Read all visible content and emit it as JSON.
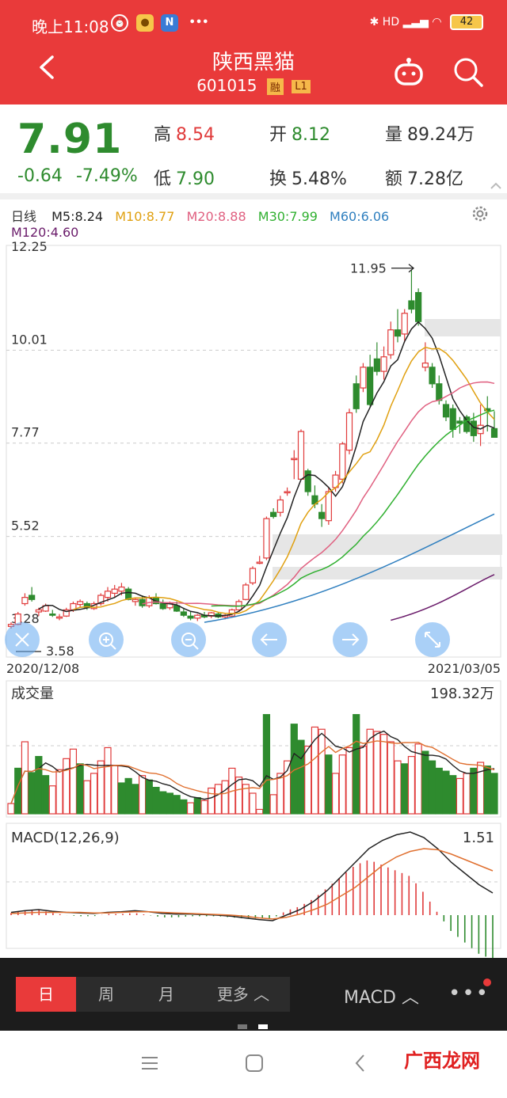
{
  "status": {
    "time": "晚上11:08",
    "battery": "42",
    "signal": "HD"
  },
  "header": {
    "title": "陕西黑猫",
    "code": "601015",
    "tag_rong": "融",
    "tag_l1": "L1"
  },
  "quote": {
    "price": "7.91",
    "change": "-0.64",
    "change_pct": "-7.49%",
    "high_label": "高",
    "high": "8.54",
    "low_label": "低",
    "low": "7.90",
    "open_label": "开",
    "open": "8.12",
    "turnover_label": "换",
    "turnover": "5.48%",
    "volume_label": "量",
    "volume": "89.24万",
    "amount_label": "额",
    "amount": "7.28亿"
  },
  "ma_legend": {
    "period": "日线",
    "items": [
      {
        "label": "M5:8.24",
        "color": "#222222"
      },
      {
        "label": "M10:8.77",
        "color": "#e0a010"
      },
      {
        "label": "M20:8.88",
        "color": "#e06080"
      },
      {
        "label": "M30:7.99",
        "color": "#30b030"
      },
      {
        "label": "M60:6.06",
        "color": "#2f7fbf"
      },
      {
        "label": "M120:4.60",
        "color": "#6a1b6a"
      }
    ]
  },
  "chart_labels": {
    "y_ticks": [
      "12.25",
      "10.01",
      "7.77",
      "5.52",
      "3.28"
    ],
    "max_marker": "11.95",
    "min_marker": "3.58",
    "date_start": "2020/12/08",
    "date_end": "2021/03/05",
    "volume_title": "成交量",
    "volume_max": "198.32万",
    "macd_title": "MACD(12,26,9)",
    "macd_max": "1.51"
  },
  "bottom": {
    "tabs": [
      {
        "label": "日",
        "active": true
      },
      {
        "label": "周",
        "active": false
      },
      {
        "label": "月",
        "active": false
      },
      {
        "label": "更多 ︿",
        "active": false
      }
    ],
    "indicator": "MACD ︿",
    "more": "•••"
  },
  "watermark": "广西龙网",
  "colors": {
    "brand": "#e93a3a",
    "down": "#2e8b2e",
    "up": "#e03a3a"
  },
  "chart_data": {
    "type": "candlestick",
    "title": "",
    "xlabel": "",
    "ylabel": "",
    "x_range": [
      "2020/12/08",
      "2021/03/05"
    ],
    "ylim": [
      3.28,
      12.25
    ],
    "candles": [
      [
        3.35,
        3.45,
        3.3,
        3.4
      ],
      [
        3.4,
        3.7,
        3.38,
        3.65
      ],
      [
        3.9,
        4.15,
        3.85,
        4.05
      ],
      [
        4.1,
        4.3,
        3.95,
        4.0
      ],
      [
        3.7,
        3.8,
        3.6,
        3.75
      ],
      [
        3.72,
        3.9,
        3.7,
        3.85
      ],
      [
        3.65,
        3.75,
        3.58,
        3.62
      ],
      [
        3.55,
        3.65,
        3.5,
        3.58
      ],
      [
        3.6,
        3.8,
        3.58,
        3.75
      ],
      [
        3.75,
        3.95,
        3.7,
        3.9
      ],
      [
        3.88,
        4.0,
        3.8,
        3.95
      ],
      [
        3.9,
        3.95,
        3.75,
        3.8
      ],
      [
        3.78,
        3.95,
        3.75,
        3.9
      ],
      [
        3.9,
        4.15,
        3.85,
        4.1
      ],
      [
        4.05,
        4.3,
        3.95,
        4.2
      ],
      [
        4.15,
        4.35,
        4.05,
        4.25
      ],
      [
        4.2,
        4.4,
        4.1,
        4.3
      ],
      [
        4.25,
        4.3,
        3.98,
        4.0
      ],
      [
        3.95,
        4.05,
        3.85,
        4.0
      ],
      [
        4.0,
        4.1,
        3.8,
        3.85
      ],
      [
        3.85,
        4.1,
        3.8,
        4.05
      ],
      [
        4.05,
        4.15,
        3.88,
        3.9
      ],
      [
        3.9,
        4.0,
        3.75,
        3.78
      ],
      [
        3.8,
        3.95,
        3.75,
        3.9
      ],
      [
        3.85,
        3.95,
        3.7,
        3.72
      ],
      [
        3.7,
        3.8,
        3.58,
        3.62
      ],
      [
        3.6,
        3.7,
        3.5,
        3.55
      ],
      [
        3.55,
        3.65,
        3.48,
        3.62
      ],
      [
        3.62,
        3.7,
        3.55,
        3.58
      ],
      [
        3.6,
        3.7,
        3.55,
        3.68
      ],
      [
        3.65,
        3.7,
        3.55,
        3.58
      ],
      [
        3.58,
        3.65,
        3.52,
        3.62
      ],
      [
        3.6,
        3.78,
        3.58,
        3.75
      ],
      [
        3.75,
        4.0,
        3.72,
        3.95
      ],
      [
        4.0,
        4.4,
        3.98,
        4.35
      ],
      [
        4.4,
        4.8,
        4.35,
        4.75
      ],
      [
        4.9,
        5.05,
        4.85,
        4.9
      ],
      [
        5.0,
        6.0,
        4.95,
        5.95
      ],
      [
        6.1,
        6.2,
        5.95,
        6.0
      ],
      [
        6.1,
        6.5,
        6.0,
        6.4
      ],
      [
        6.6,
        6.7,
        6.5,
        6.6
      ],
      [
        7.4,
        7.6,
        6.9,
        7.4
      ],
      [
        6.9,
        8.1,
        6.9,
        8.05
      ],
      [
        7.1,
        7.15,
        6.5,
        6.6
      ],
      [
        6.5,
        6.75,
        6.2,
        6.3
      ],
      [
        6.1,
        6.3,
        5.75,
        5.95
      ],
      [
        5.9,
        6.7,
        5.8,
        6.6
      ],
      [
        6.7,
        7.1,
        6.6,
        7.0
      ],
      [
        6.9,
        7.8,
        6.8,
        7.75
      ],
      [
        7.6,
        8.6,
        7.5,
        8.5
      ],
      [
        9.2,
        9.4,
        8.5,
        8.6
      ],
      [
        9.1,
        9.7,
        9.0,
        9.6
      ],
      [
        9.6,
        9.9,
        8.65,
        8.7
      ],
      [
        9.8,
        10.2,
        9.4,
        9.5
      ],
      [
        9.5,
        10.1,
        9.3,
        9.85
      ],
      [
        9.9,
        10.7,
        9.8,
        10.5
      ],
      [
        10.5,
        11.0,
        10.2,
        10.35
      ],
      [
        10.4,
        11.0,
        10.2,
        10.9
      ],
      [
        11.2,
        11.95,
        10.9,
        11.0
      ],
      [
        11.4,
        11.5,
        10.6,
        10.7
      ],
      [
        9.6,
        10.2,
        9.5,
        9.7
      ],
      [
        9.6,
        9.7,
        9.1,
        9.2
      ],
      [
        9.2,
        9.4,
        8.7,
        8.8
      ],
      [
        8.7,
        8.8,
        8.3,
        8.4
      ],
      [
        8.6,
        8.7,
        7.9,
        8.1
      ],
      [
        8.3,
        8.4,
        8.0,
        8.25
      ],
      [
        8.4,
        8.45,
        8.0,
        8.05
      ],
      [
        8.3,
        8.5,
        7.8,
        7.95
      ],
      [
        8.0,
        8.7,
        7.7,
        8.2
      ],
      [
        8.6,
        8.9,
        8.05,
        8.55
      ],
      [
        8.12,
        8.54,
        7.9,
        7.91
      ]
    ],
    "volume": [
      [
        14,
        1
      ],
      [
        62,
        0
      ],
      [
        98,
        1
      ],
      [
        56,
        0
      ],
      [
        78,
        0
      ],
      [
        52,
        0
      ],
      [
        38,
        1
      ],
      [
        60,
        1
      ],
      [
        75,
        1
      ],
      [
        88,
        1
      ],
      [
        68,
        0
      ],
      [
        45,
        1
      ],
      [
        55,
        1
      ],
      [
        72,
        1
      ],
      [
        90,
        1
      ],
      [
        66,
        1
      ],
      [
        42,
        0
      ],
      [
        48,
        0
      ],
      [
        40,
        0
      ],
      [
        52,
        1
      ],
      [
        46,
        0
      ],
      [
        36,
        0
      ],
      [
        30,
        0
      ],
      [
        28,
        0
      ],
      [
        25,
        0
      ],
      [
        19,
        0
      ],
      [
        15,
        1
      ],
      [
        22,
        0
      ],
      [
        18,
        1
      ],
      [
        35,
        1
      ],
      [
        40,
        1
      ],
      [
        45,
        1
      ],
      [
        62,
        1
      ],
      [
        50,
        1
      ],
      [
        40,
        1
      ],
      [
        28,
        1
      ],
      [
        6,
        1
      ],
      [
        135,
        0
      ],
      [
        26,
        1
      ],
      [
        55,
        1
      ],
      [
        72,
        1
      ],
      [
        122,
        0
      ],
      [
        100,
        0
      ],
      [
        92,
        1
      ],
      [
        118,
        1
      ],
      [
        115,
        1
      ],
      [
        80,
        0
      ],
      [
        55,
        1
      ],
      [
        80,
        1
      ],
      [
        90,
        1
      ],
      [
        135,
        0
      ],
      [
        92,
        1
      ],
      [
        115,
        1
      ],
      [
        112,
        1
      ],
      [
        108,
        1
      ],
      [
        98,
        1
      ],
      [
        72,
        1
      ],
      [
        68,
        0
      ],
      [
        78,
        1
      ],
      [
        95,
        1
      ],
      [
        85,
        0
      ],
      [
        72,
        0
      ],
      [
        62,
        0
      ],
      [
        58,
        0
      ],
      [
        52,
        0
      ],
      [
        48,
        1
      ],
      [
        55,
        1
      ],
      [
        62,
        0
      ],
      [
        70,
        1
      ],
      [
        65,
        0
      ],
      [
        55,
        0
      ]
    ],
    "macd": {
      "dif": [
        0.05,
        0.08,
        0.1,
        0.07,
        0.05,
        0.04,
        0.03,
        0.05,
        0.06,
        0.08,
        0.06,
        0.03,
        0.02,
        0.02,
        0.01,
        0.0,
        -0.02,
        -0.05,
        -0.08,
        -0.1,
        0.0,
        0.1,
        0.25,
        0.45,
        0.7,
        0.95,
        1.2,
        1.35,
        1.45,
        1.5,
        1.4,
        1.2,
        0.95,
        0.75,
        0.55,
        0.4
      ],
      "dea": [
        0.03,
        0.04,
        0.05,
        0.05,
        0.05,
        0.05,
        0.04,
        0.04,
        0.05,
        0.06,
        0.06,
        0.05,
        0.04,
        0.03,
        0.02,
        0.01,
        0.0,
        -0.02,
        -0.05,
        -0.07,
        -0.04,
        0.02,
        0.1,
        0.2,
        0.35,
        0.5,
        0.7,
        0.9,
        1.05,
        1.15,
        1.2,
        1.18,
        1.1,
        1.0,
        0.9,
        0.8
      ]
    }
  }
}
